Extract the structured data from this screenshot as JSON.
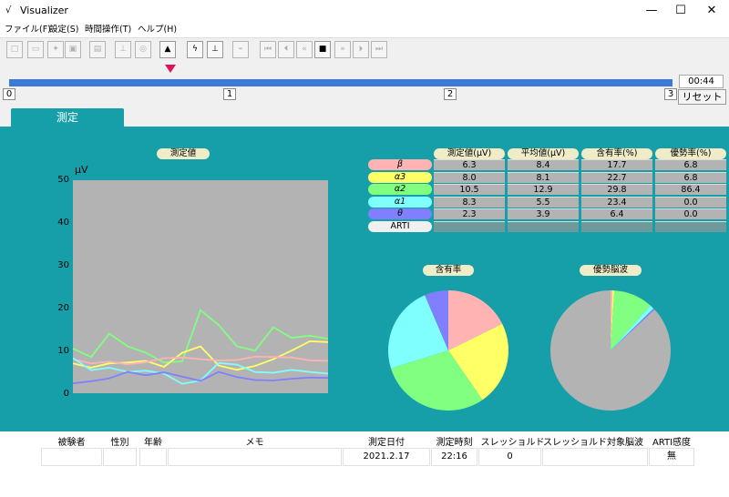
{
  "window": {
    "icon": "√",
    "title": "Visualizer",
    "minimize": "—",
    "maximize": "☐",
    "close": "✕"
  },
  "menu": [
    {
      "label": "ファイル(F)"
    },
    {
      "label": "設定(S)"
    },
    {
      "label": "時間操作(T)"
    },
    {
      "label": "ヘルプ(H)"
    }
  ],
  "toolbar": [
    {
      "name": "new-file-icon",
      "glyph": "□",
      "active": false
    },
    {
      "name": "open-folder-icon",
      "glyph": "▭",
      "active": false
    },
    {
      "name": "connect-icon",
      "glyph": "✦",
      "active": false
    },
    {
      "name": "save-icon",
      "glyph": "▣",
      "active": false
    },
    {
      "name": "print-icon",
      "glyph": "▤",
      "active": false
    },
    {
      "name": "upload-icon",
      "glyph": "⊥",
      "active": false
    },
    {
      "name": "record-icon",
      "glyph": "◎",
      "active": false
    },
    {
      "name": "bell-icon",
      "glyph": "▲",
      "active": true
    },
    {
      "name": "lightning-icon",
      "glyph": "ϟ",
      "active": true
    },
    {
      "name": "chart-icon",
      "glyph": "⊥",
      "active": true
    },
    {
      "name": "brush-icon",
      "glyph": "⌁",
      "active": false
    },
    {
      "name": "skip-start-icon",
      "glyph": "⏮",
      "active": false
    },
    {
      "name": "step-back-icon",
      "glyph": "⏴",
      "active": false
    },
    {
      "name": "rewind-icon",
      "glyph": "«",
      "active": false
    },
    {
      "name": "stop-icon",
      "glyph": "■",
      "active": true
    },
    {
      "name": "fast-forward-icon",
      "glyph": "»",
      "active": false
    },
    {
      "name": "step-forward-icon",
      "glyph": "⏵",
      "active": false
    },
    {
      "name": "skip-end-icon",
      "glyph": "⏭",
      "active": false
    }
  ],
  "timeline": {
    "time": "00:44",
    "ticks": [
      "0",
      "1",
      "2",
      "3"
    ],
    "reset_label": "リセット",
    "marker_fraction": 0.24
  },
  "tab": {
    "label": "測定"
  },
  "graph": {
    "caption": "測定値",
    "unit": "μV",
    "y_ticks": [
      "50",
      "40",
      "30",
      "20",
      "10",
      "0"
    ],
    "background": "#b3b3b3"
  },
  "chart_data": [
    {
      "type": "line",
      "title": "測定値",
      "ylabel": "μV",
      "ylim": [
        0,
        50
      ],
      "x": [
        0,
        1,
        2,
        3,
        4,
        5,
        6,
        7,
        8,
        9,
        10,
        11,
        12,
        13,
        14
      ],
      "series": [
        {
          "color": "#80ff80",
          "values": [
            10.5,
            8.5,
            14,
            11,
            9.5,
            7.2,
            7.5,
            19.5,
            16,
            11,
            10,
            15.5,
            13,
            13.5,
            12.8
          ]
        },
        {
          "color": "#ffff66",
          "values": [
            7,
            6,
            7,
            7.2,
            7.6,
            6.2,
            9.5,
            11,
            6.5,
            5.5,
            6.4,
            8,
            10,
            12.2,
            12
          ]
        },
        {
          "color": "#ffb3b3",
          "values": [
            8,
            7,
            7.4,
            6.8,
            7.3,
            8.2,
            8.4,
            8,
            7.7,
            7.8,
            8.6,
            8.5,
            8.4,
            7.7,
            7.6
          ]
        },
        {
          "color": "#80ffff",
          "values": [
            8.3,
            5.4,
            6,
            5,
            5.3,
            4.6,
            2.2,
            3,
            7.1,
            6.7,
            5,
            4.8,
            5.5,
            5,
            4.6
          ]
        },
        {
          "color": "#8080ff",
          "values": [
            2.3,
            2.8,
            3.5,
            5,
            4.2,
            4.9,
            3.9,
            2.9,
            5,
            3.8,
            3.1,
            3,
            3.4,
            3.7,
            3.6
          ]
        }
      ]
    },
    {
      "type": "pie",
      "title": "含有率",
      "labels": [
        "β",
        "α3",
        "α2",
        "α1",
        "θ"
      ],
      "values": [
        17.7,
        22.7,
        29.8,
        23.4,
        6.4
      ],
      "colors": [
        "#ffb3b3",
        "#ffff66",
        "#80ff80",
        "#80ffff",
        "#8080ff"
      ]
    },
    {
      "type": "pie",
      "title": "優勢脳波",
      "labels": [
        "β",
        "α3",
        "α2",
        "α1",
        "θ",
        "other"
      ],
      "values": [
        0.5,
        0.5,
        10.5,
        1.2,
        0.4,
        86.9
      ],
      "colors": [
        "#ffb3b3",
        "#ffff66",
        "#80ff80",
        "#80ffff",
        "#8080ff",
        "#b3b3b3"
      ]
    },
    {
      "type": "table",
      "columns": [
        "測定値(μV)",
        "平均値(μV)",
        "含有率(%)",
        "優勢率(%)"
      ],
      "rows": [
        {
          "label": "β",
          "color": "#ffb3b3",
          "values": [
            "6.3",
            "8.4",
            "17.7",
            "6.8"
          ]
        },
        {
          "label": "α3",
          "color": "#ffff66",
          "values": [
            "8.0",
            "8.1",
            "22.7",
            "6.8"
          ]
        },
        {
          "label": "α2",
          "color": "#80ff80",
          "values": [
            "10.5",
            "12.9",
            "29.8",
            "86.4"
          ]
        },
        {
          "label": "α1",
          "color": "#80ffff",
          "values": [
            "8.3",
            "5.5",
            "23.4",
            "0.0"
          ]
        },
        {
          "label": "θ",
          "color": "#8080ff",
          "values": [
            "2.3",
            "3.9",
            "6.4",
            "0.0"
          ]
        },
        {
          "label": "ARTI",
          "color": "#f0f0f0",
          "values": [
            "",
            "",
            "",
            ""
          ]
        }
      ]
    }
  ],
  "pies": {
    "content_caption": "含有率",
    "dominant_caption": "優勢脳波"
  },
  "info": {
    "headers": [
      "被験者",
      "性別",
      "年齢",
      "メモ",
      "測定日付",
      "測定時刻",
      "スレッショルド",
      "スレッショルド対象脳波",
      "ARTI感度"
    ],
    "values": [
      "",
      "",
      "",
      "",
      "2021.2.17",
      "22:16",
      "0",
      "",
      "無"
    ]
  }
}
